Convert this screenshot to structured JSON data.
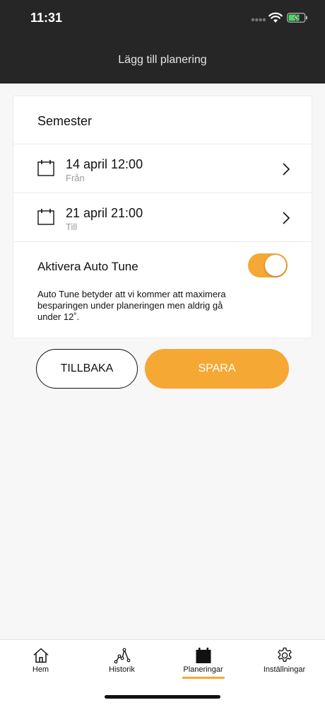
{
  "status": {
    "time": "11:31"
  },
  "header": {
    "title": "Lägg till planering"
  },
  "plan": {
    "name": "Semester",
    "from": {
      "date": "14 april 12:00",
      "label": "Från"
    },
    "to": {
      "date": "21 april 21:00",
      "label": "Till"
    },
    "auto_tune": {
      "label": "Aktivera Auto Tune",
      "enabled": true,
      "description": "Auto Tune betyder att vi kommer att maximera besparingen under planeringen men aldrig gå under 12˚."
    }
  },
  "actions": {
    "back": "TILLBAKA",
    "save": "SPARA"
  },
  "tabs": [
    {
      "label": "Hem",
      "icon": "home-icon"
    },
    {
      "label": "Historik",
      "icon": "history-icon"
    },
    {
      "label": "Planeringar",
      "icon": "calendar-icon",
      "active": true
    },
    {
      "label": "Inställningar",
      "icon": "gear-icon"
    }
  ],
  "colors": {
    "accent": "#f5a834",
    "header": "#262626",
    "background": "#f7f7f7",
    "battery": "#4cd964"
  }
}
